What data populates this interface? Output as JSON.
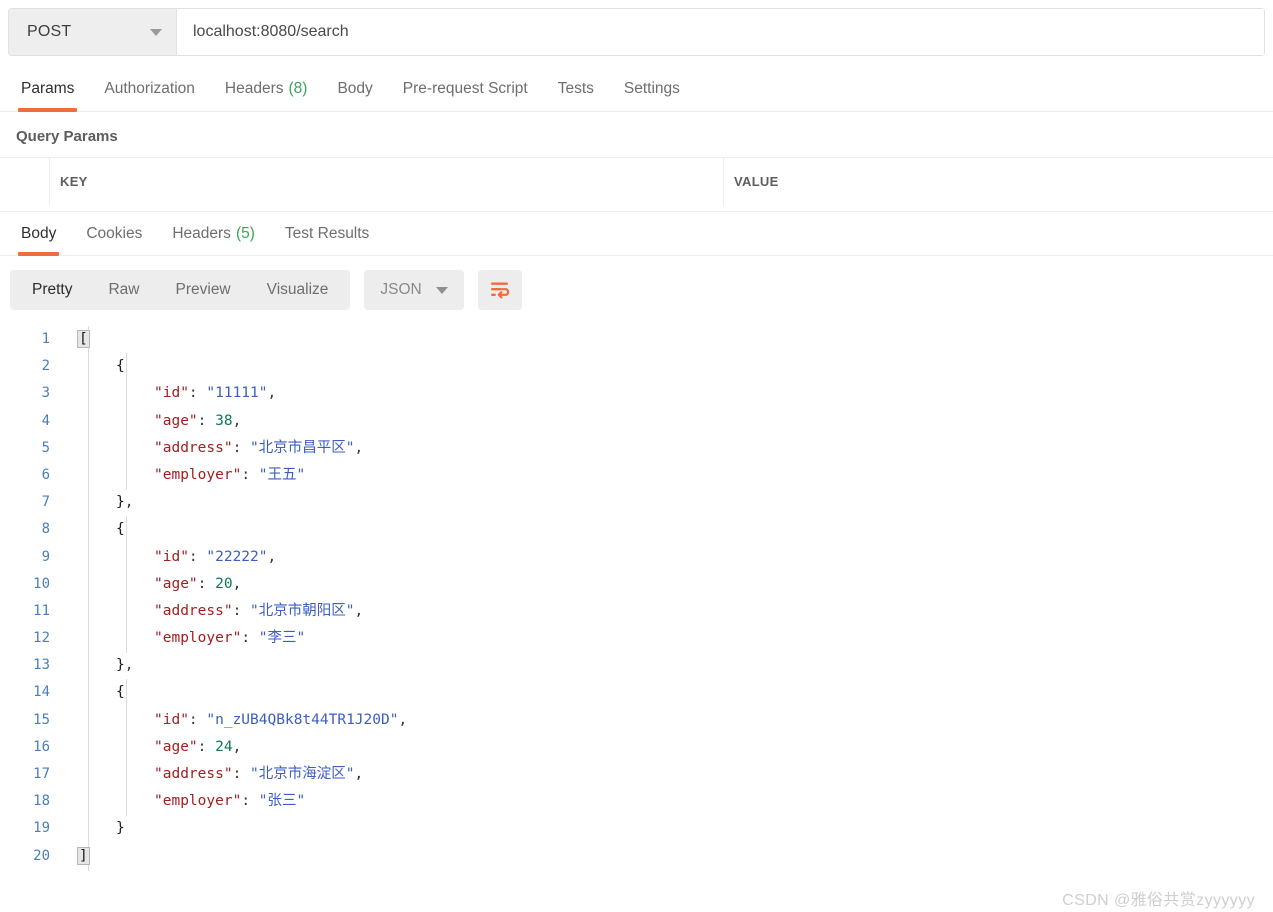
{
  "request": {
    "method": "POST",
    "url": "localhost:8080/search",
    "tabs": [
      {
        "label": "Params",
        "count": "",
        "active": true
      },
      {
        "label": "Authorization",
        "count": "",
        "active": false
      },
      {
        "label": "Headers",
        "count": "(8)",
        "active": false
      },
      {
        "label": "Body",
        "count": "",
        "active": false
      },
      {
        "label": "Pre-request Script",
        "count": "",
        "active": false
      },
      {
        "label": "Tests",
        "count": "",
        "active": false
      },
      {
        "label": "Settings",
        "count": "",
        "active": false
      }
    ],
    "params_section_title": "Query Params",
    "params_columns": {
      "key": "KEY",
      "value": "VALUE"
    }
  },
  "response": {
    "tabs": [
      {
        "label": "Body",
        "count": "",
        "active": true
      },
      {
        "label": "Cookies",
        "count": "",
        "active": false
      },
      {
        "label": "Headers",
        "count": "(5)",
        "active": false
      },
      {
        "label": "Test Results",
        "count": "",
        "active": false
      }
    ],
    "view_modes": [
      {
        "label": "Pretty",
        "active": true
      },
      {
        "label": "Raw",
        "active": false
      },
      {
        "label": "Preview",
        "active": false
      },
      {
        "label": "Visualize",
        "active": false
      }
    ],
    "format": "JSON",
    "wrap_icon": "word-wrap-icon",
    "body_lines": [
      {
        "n": "1",
        "indent": 0,
        "tokens": [
          {
            "t": "brace-hl",
            "v": "["
          }
        ]
      },
      {
        "n": "2",
        "indent": 1,
        "tokens": [
          {
            "t": "brace",
            "v": "{"
          }
        ]
      },
      {
        "n": "3",
        "indent": 2,
        "tokens": [
          {
            "t": "key",
            "v": "\"id\""
          },
          {
            "t": "punct",
            "v": ": "
          },
          {
            "t": "str",
            "v": "\"11111\""
          },
          {
            "t": "punct",
            "v": ","
          }
        ]
      },
      {
        "n": "4",
        "indent": 2,
        "tokens": [
          {
            "t": "key",
            "v": "\"age\""
          },
          {
            "t": "punct",
            "v": ": "
          },
          {
            "t": "num",
            "v": "38"
          },
          {
            "t": "punct",
            "v": ","
          }
        ]
      },
      {
        "n": "5",
        "indent": 2,
        "tokens": [
          {
            "t": "key",
            "v": "\"address\""
          },
          {
            "t": "punct",
            "v": ": "
          },
          {
            "t": "str",
            "v": "\"北京市昌平区\""
          },
          {
            "t": "punct",
            "v": ","
          }
        ]
      },
      {
        "n": "6",
        "indent": 2,
        "tokens": [
          {
            "t": "key",
            "v": "\"employer\""
          },
          {
            "t": "punct",
            "v": ": "
          },
          {
            "t": "str",
            "v": "\"王五\""
          }
        ]
      },
      {
        "n": "7",
        "indent": 1,
        "tokens": [
          {
            "t": "brace",
            "v": "}"
          },
          {
            "t": "punct",
            "v": ","
          }
        ]
      },
      {
        "n": "8",
        "indent": 1,
        "tokens": [
          {
            "t": "brace",
            "v": "{"
          }
        ]
      },
      {
        "n": "9",
        "indent": 2,
        "tokens": [
          {
            "t": "key",
            "v": "\"id\""
          },
          {
            "t": "punct",
            "v": ": "
          },
          {
            "t": "str",
            "v": "\"22222\""
          },
          {
            "t": "punct",
            "v": ","
          }
        ]
      },
      {
        "n": "10",
        "indent": 2,
        "tokens": [
          {
            "t": "key",
            "v": "\"age\""
          },
          {
            "t": "punct",
            "v": ": "
          },
          {
            "t": "num",
            "v": "20"
          },
          {
            "t": "punct",
            "v": ","
          }
        ]
      },
      {
        "n": "11",
        "indent": 2,
        "tokens": [
          {
            "t": "key",
            "v": "\"address\""
          },
          {
            "t": "punct",
            "v": ": "
          },
          {
            "t": "str",
            "v": "\"北京市朝阳区\""
          },
          {
            "t": "punct",
            "v": ","
          }
        ]
      },
      {
        "n": "12",
        "indent": 2,
        "tokens": [
          {
            "t": "key",
            "v": "\"employer\""
          },
          {
            "t": "punct",
            "v": ": "
          },
          {
            "t": "str",
            "v": "\"李三\""
          }
        ]
      },
      {
        "n": "13",
        "indent": 1,
        "tokens": [
          {
            "t": "brace",
            "v": "}"
          },
          {
            "t": "punct",
            "v": ","
          }
        ]
      },
      {
        "n": "14",
        "indent": 1,
        "tokens": [
          {
            "t": "brace",
            "v": "{"
          }
        ]
      },
      {
        "n": "15",
        "indent": 2,
        "tokens": [
          {
            "t": "key",
            "v": "\"id\""
          },
          {
            "t": "punct",
            "v": ": "
          },
          {
            "t": "str",
            "v": "\"n_zUB4QBk8t44TR1J20D\""
          },
          {
            "t": "punct",
            "v": ","
          }
        ]
      },
      {
        "n": "16",
        "indent": 2,
        "tokens": [
          {
            "t": "key",
            "v": "\"age\""
          },
          {
            "t": "punct",
            "v": ": "
          },
          {
            "t": "num",
            "v": "24"
          },
          {
            "t": "punct",
            "v": ","
          }
        ]
      },
      {
        "n": "17",
        "indent": 2,
        "tokens": [
          {
            "t": "key",
            "v": "\"address\""
          },
          {
            "t": "punct",
            "v": ": "
          },
          {
            "t": "str",
            "v": "\"北京市海淀区\""
          },
          {
            "t": "punct",
            "v": ","
          }
        ]
      },
      {
        "n": "18",
        "indent": 2,
        "tokens": [
          {
            "t": "key",
            "v": "\"employer\""
          },
          {
            "t": "punct",
            "v": ": "
          },
          {
            "t": "str",
            "v": "\"张三\""
          }
        ]
      },
      {
        "n": "19",
        "indent": 1,
        "tokens": [
          {
            "t": "brace",
            "v": "}"
          }
        ]
      },
      {
        "n": "20",
        "indent": 0,
        "tokens": [
          {
            "t": "brace-hl",
            "v": "]"
          }
        ]
      }
    ]
  },
  "watermark": "CSDN @雅俗共赏zyyyyyy",
  "colors": {
    "accent": "#ef6c3e",
    "count_green": "#3aa757",
    "json_key": "#a02020",
    "json_string": "#3c5ec0",
    "json_number": "#0c7a4e",
    "gutter_blue": "#4a7ebb"
  }
}
